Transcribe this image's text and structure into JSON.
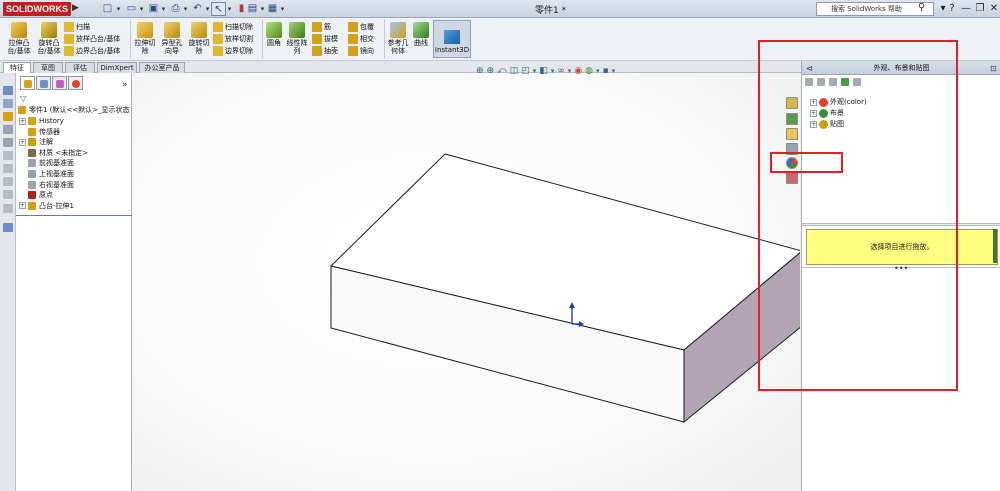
{
  "app": {
    "logo_text": "SOLIDWORKS",
    "doc_title": "零件1 *",
    "search_placeholder": "搜索 SolidWorks 帮助",
    "win_help": "?",
    "win_min": "—",
    "win_restore": "❐",
    "win_close": "✕"
  },
  "commands": {
    "extrude_boss": "拉伸凸\n台/基体",
    "revolve_boss": "旋转凸\n台/基体",
    "sweep": "扫描",
    "loft_boss": "放样凸台/基体",
    "boundary_boss": "边界凸台/基体",
    "extrude_cut": "拉伸切\n除",
    "hole_wizard": "异型孔\n向导",
    "revolve_cut": "旋转切\n除",
    "swept_cut": "扫描切除",
    "lofted_cut": "放样切割",
    "boundary_cut": "边界切除",
    "fillet": "圆角",
    "linear_pattern": "线性阵\n列",
    "rib": "筋",
    "draft": "拔模",
    "shell": "抽壳",
    "wrap": "包覆",
    "intersect": "相交",
    "mirror": "镜向",
    "ref_geometry": "参考几\n何体",
    "curves": "曲线",
    "instant3d": "Instant3D"
  },
  "tabs": [
    "特征",
    "草图",
    "评估",
    "DimXpert",
    "办公室产品"
  ],
  "feature_tree": {
    "root": "零件1 (默认<<默认>_显示状态",
    "items": [
      {
        "label": "History",
        "color": "#d4a017",
        "exp": "+"
      },
      {
        "label": "传感器",
        "color": "#d4a017",
        "exp": ""
      },
      {
        "label": "注解",
        "color": "#c9a000",
        "exp": "+"
      },
      {
        "label": "材质 <未指定>",
        "color": "#7b6b4a",
        "exp": ""
      },
      {
        "label": "前视基准面",
        "color": "#9aa3b0",
        "exp": ""
      },
      {
        "label": "上视基准面",
        "color": "#9aa3b0",
        "exp": ""
      },
      {
        "label": "右视基准面",
        "color": "#9aa3b0",
        "exp": ""
      },
      {
        "label": "原点",
        "color": "#b02020",
        "exp": ""
      },
      {
        "label": "凸台-拉伸1",
        "color": "#d4a017",
        "exp": "+"
      }
    ]
  },
  "task_pane": {
    "title": "外观、布景和贴图",
    "tree": [
      {
        "label": "外观(color)",
        "color": "#e2402a"
      },
      {
        "label": "布景",
        "color": "#3a8a3a"
      },
      {
        "label": "贴图",
        "color": "#c9a000"
      }
    ],
    "hint": "选择项目进行拖放。",
    "dots": "•••"
  },
  "colors": {
    "annotation": "#e01f26",
    "box_top": "#ffffff",
    "box_front": "#f8f8f8",
    "box_side": "#b3a4b3",
    "hint_bg": "#ffff80"
  }
}
